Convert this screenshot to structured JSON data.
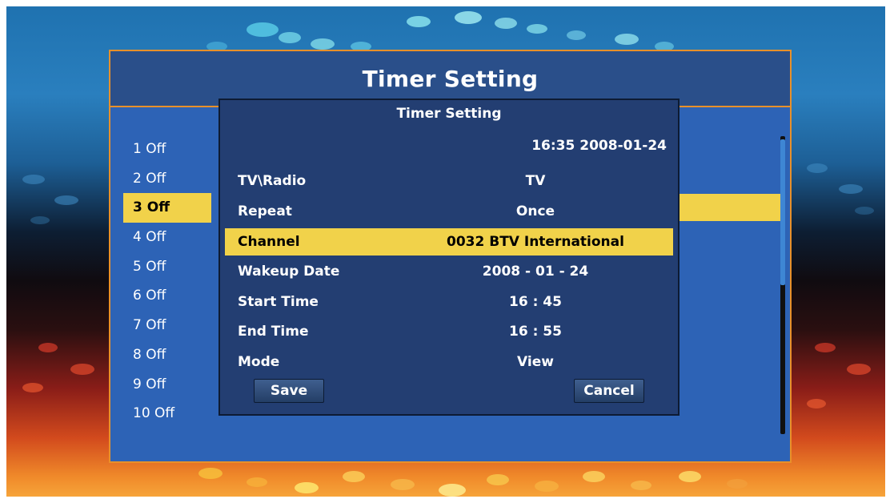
{
  "window": {
    "title": "Timer Setting"
  },
  "timer_list": [
    {
      "label": "1 Off"
    },
    {
      "label": "2 Off"
    },
    {
      "label": "3 Off",
      "selected": true
    },
    {
      "label": "4 Off"
    },
    {
      "label": "5 Off"
    },
    {
      "label": "6 Off"
    },
    {
      "label": "7 Off"
    },
    {
      "label": "8 Off"
    },
    {
      "label": "9 Off"
    },
    {
      "label": "10 Off"
    }
  ],
  "dialog": {
    "title": "Timer Setting",
    "datetime": "16:35 2008-01-24",
    "fields": [
      {
        "label": "TV\\Radio",
        "value": "TV"
      },
      {
        "label": "Repeat",
        "value": "Once"
      },
      {
        "label": "Channel",
        "value": "0032 BTV International",
        "selected": true
      },
      {
        "label": "Wakeup Date",
        "value": "2008 - 01 - 24"
      },
      {
        "label": "Start Time",
        "value": "16 : 45"
      },
      {
        "label": "End Time",
        "value": "16 : 55"
      },
      {
        "label": "Mode",
        "value": "View"
      }
    ],
    "save_label": "Save",
    "cancel_label": "Cancel"
  },
  "colors": {
    "frame_border": "#e8902a",
    "panel_bg": "#2d63b6",
    "dialog_bg": "#233e72",
    "highlight": "#f1d24a"
  }
}
